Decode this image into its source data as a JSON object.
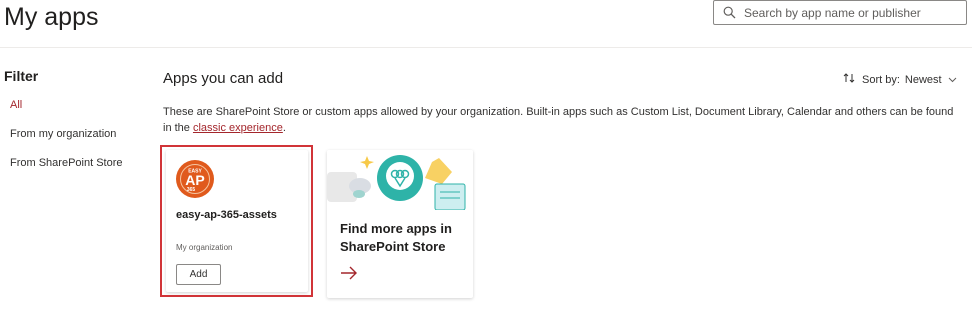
{
  "page": {
    "title": "My apps"
  },
  "search": {
    "placeholder": "Search by app name or publisher",
    "value": ""
  },
  "filter": {
    "title": "Filter",
    "items": [
      {
        "label": "All",
        "active": true
      },
      {
        "label": "From my organization",
        "active": false
      },
      {
        "label": "From SharePoint Store",
        "active": false
      }
    ]
  },
  "main": {
    "section_title": "Apps you can add",
    "sort": {
      "label": "Sort by:",
      "value": "Newest"
    },
    "description": {
      "text": "These are SharePoint Store or custom apps allowed by your organization. Built-in apps such as Custom List, Document Library, Calendar and others can be found in the ",
      "link_text": "classic experience",
      "suffix": "."
    },
    "apps": [
      {
        "name": "easy-ap-365-assets",
        "source": "My organization",
        "button_label": "Add",
        "logo_text_top": "EASY",
        "logo_text_main": "AP",
        "logo_text_bottom": "365",
        "selected": true
      }
    ],
    "store_card": {
      "title": "Find more apps in SharePoint Store"
    }
  },
  "colors": {
    "accent": "#a4262c",
    "selection_border": "#d13438",
    "logo_orange": "#e05a1d",
    "illustration_teal": "#2eb3a8",
    "illustration_yellow": "#f7c948"
  },
  "icons": {
    "search": "search-icon",
    "sort": "sort-arrows-icon",
    "chevron": "chevron-down-icon",
    "arrow": "arrow-right-icon"
  }
}
